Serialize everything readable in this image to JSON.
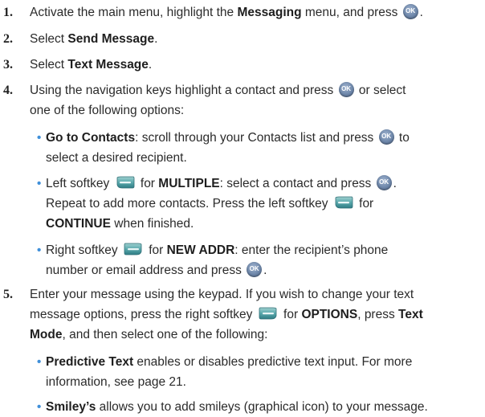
{
  "steps": [
    {
      "num": "1.",
      "parts": {
        "a": "Activate the main menu, highlight the ",
        "b": "Messaging",
        "c": " menu, and press ",
        "d": "."
      }
    },
    {
      "num": "2.",
      "parts": {
        "a": "Select ",
        "b": "Send Message",
        "c": "."
      }
    },
    {
      "num": "3.",
      "parts": {
        "a": "Select ",
        "b": "Text Message",
        "c": "."
      }
    },
    {
      "num": "4.",
      "parts": {
        "a": "Using the navigation keys highlight a contact and press ",
        "b": " or select",
        "c": "one of the following options:"
      }
    },
    {
      "num": "5.",
      "parts": {
        "a": "Enter your message using the keypad. If you wish to change your text",
        "b": "message options, press the right softkey ",
        "c": " for ",
        "d": "OPTIONS",
        "e": ", press ",
        "f": "Text",
        "g": "Mode",
        "h": ", and then select one of the following:"
      }
    }
  ],
  "step4_options": [
    {
      "parts": {
        "a": "Go to Contacts",
        "b": ": scroll through your Contacts list and press ",
        "c": " to",
        "d": "select a desired recipient."
      }
    },
    {
      "parts": {
        "a": "Left softkey ",
        "b": " for ",
        "c": "MULTIPLE",
        "d": ": select a contact and press ",
        "e": ".",
        "f": "Repeat to add more contacts. Press the left softkey ",
        "g": " for",
        "h": "CONTINUE",
        "i": " when finished."
      }
    },
    {
      "parts": {
        "a": "Right softkey ",
        "b": " for ",
        "c": "NEW ADDR",
        "d": ": enter the recipient’s phone",
        "e": "number or email address and press ",
        "f": "."
      }
    }
  ],
  "step5_options": [
    {
      "parts": {
        "a": "Predictive Text",
        "b": " enables or disables predictive text input. For more",
        "c": "information, see page 21."
      }
    },
    {
      "parts": {
        "a": "Smiley’s",
        "b": " allows you to add smileys (graphical icon) to your message."
      }
    }
  ],
  "bullet_char": "•",
  "icons": {
    "ok": "ok-key-icon",
    "left_softkey": "left-softkey-icon",
    "right_softkey": "right-softkey-icon"
  },
  "colors": {
    "bullet": "#3f8fd9",
    "text": "#2b2b2b",
    "ok_key": "#6d86a9",
    "softkey": "#4a9a9f"
  }
}
